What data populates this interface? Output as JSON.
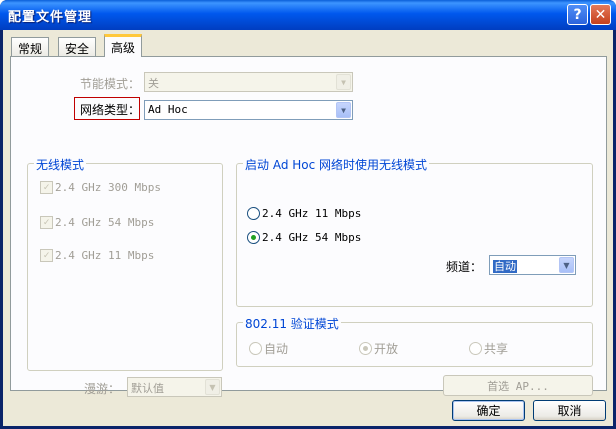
{
  "window": {
    "title": "配置文件管理",
    "help_glyph": "?",
    "close_glyph": "✕"
  },
  "tabs": [
    {
      "label": "常规"
    },
    {
      "label": "安全"
    },
    {
      "label": "高级"
    }
  ],
  "power_mode": {
    "label": "节能模式：",
    "value": "关"
  },
  "network_type": {
    "label": "网络类型：",
    "value": "Ad Hoc"
  },
  "wireless_mode": {
    "title": "无线模式",
    "options": [
      {
        "label": "2.4 GHz 300 Mbps",
        "checked": true
      },
      {
        "label": "2.4 GHz 54 Mbps",
        "checked": true
      },
      {
        "label": "2.4 GHz 11 Mbps",
        "checked": true
      }
    ]
  },
  "adhoc_mode": {
    "title": "启动 Ad Hoc 网络时使用无线模式",
    "options": [
      {
        "label": "2.4 GHz 11 Mbps",
        "selected": false
      },
      {
        "label": "2.4 GHz 54 Mbps",
        "selected": true
      }
    ],
    "channel_label": "频道：",
    "channel_value": "自动"
  },
  "auth_mode": {
    "title": "802.11 验证模式",
    "options": [
      {
        "label": "自动",
        "selected": false
      },
      {
        "label": "开放",
        "selected": true
      },
      {
        "label": "共享",
        "selected": false
      }
    ]
  },
  "roaming": {
    "label": "漫游：",
    "value": "默认值"
  },
  "preferred_ap_button": "首选 AP...",
  "ok_button": "确定",
  "cancel_button": "取消",
  "icons": {
    "checkmark": "✓",
    "dropdown": "▼"
  }
}
